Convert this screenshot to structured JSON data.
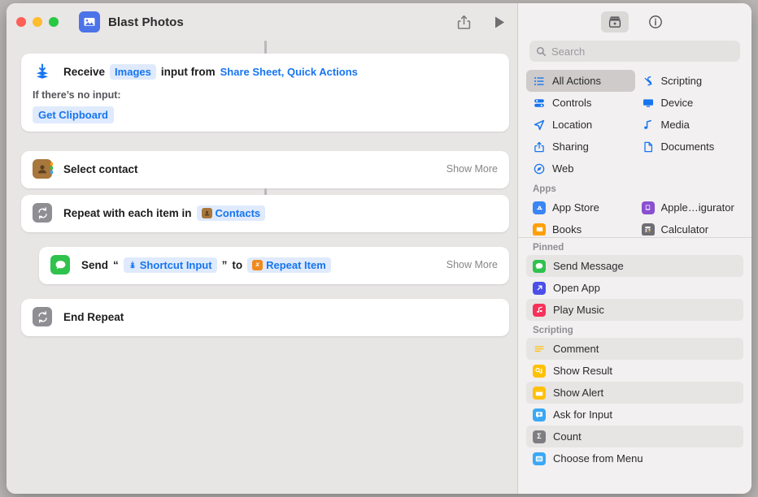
{
  "window": {
    "title": "Blast Photos",
    "app_icon": "photos-icon",
    "traffic_lights": [
      "close-button",
      "minimize-button",
      "zoom-button"
    ],
    "toolbar": {
      "share_label": "share-icon",
      "run_label": "play-icon"
    }
  },
  "workflow": {
    "actions": [
      {
        "id": "receive",
        "icon": "receive-input-icon",
        "prefix": "Receive",
        "token1": "Images",
        "middle": "input from",
        "token2": "Share Sheet, Quick Actions",
        "sub_label": "If there’s no input:",
        "sub_value": "Get Clipboard"
      },
      {
        "id": "select-contact",
        "icon": "contacts-icon",
        "title": "Select contact",
        "show_more": "Show More"
      },
      {
        "id": "repeat-with-each",
        "icon": "repeat-icon",
        "prefix": "Repeat with each item in",
        "token": "Contacts",
        "token_icon": "contacts-icon"
      },
      {
        "id": "send-message",
        "icon": "messages-icon",
        "prefix": "Send",
        "quote_open": "“",
        "token1": "Shortcut Input",
        "token1_icon": "shortcut-input-icon",
        "quote_close": "”",
        "middle": "to",
        "token2": "Repeat Item",
        "token2_icon": "variable-icon",
        "show_more": "Show More"
      },
      {
        "id": "end-repeat",
        "icon": "repeat-icon",
        "title": "End Repeat"
      }
    ]
  },
  "sidebar": {
    "tools": [
      {
        "name": "action-library-button",
        "icon": "library-icon",
        "selected": true
      },
      {
        "name": "info-button",
        "icon": "info-circle-icon",
        "selected": false
      }
    ],
    "search": {
      "placeholder": "Search",
      "value": "",
      "icon": "search-icon"
    },
    "categories": [
      {
        "label": "All Actions",
        "icon": "list-icon",
        "selected": true
      },
      {
        "label": "Scripting",
        "icon": "scripting-icon",
        "selected": false
      },
      {
        "label": "Controls",
        "icon": "controls-icon",
        "selected": false
      },
      {
        "label": "Device",
        "icon": "device-icon",
        "selected": false
      },
      {
        "label": "Location",
        "icon": "location-icon",
        "selected": false
      },
      {
        "label": "Media",
        "icon": "media-note-icon",
        "selected": false
      },
      {
        "label": "Sharing",
        "icon": "share-icon",
        "selected": false
      },
      {
        "label": "Documents",
        "icon": "document-icon",
        "selected": false
      },
      {
        "label": "Web",
        "icon": "compass-icon",
        "selected": false
      }
    ],
    "apps_header": "Apps",
    "apps": [
      {
        "label": "App Store",
        "icon": "app-store-icon",
        "color": "#3b85f5"
      },
      {
        "label": "Apple…igurator",
        "icon": "apple-configurator-icon",
        "color": "#8a4fd1"
      },
      {
        "label": "Books",
        "icon": "books-icon",
        "color": "#ff9f0a"
      },
      {
        "label": "Calculator",
        "icon": "calculator-icon",
        "color": "#6e6e73"
      }
    ],
    "pinned_header": "Pinned",
    "pinned": [
      {
        "label": "Send Message",
        "icon": "messages-icon",
        "color": "#2fc24c"
      },
      {
        "label": "Open App",
        "icon": "open-app-icon",
        "color": "#4c4fe8"
      },
      {
        "label": "Play Music",
        "icon": "music-icon",
        "color": "#f8315a"
      }
    ],
    "scripting_header": "Scripting",
    "scripting": [
      {
        "label": "Comment",
        "icon": "comment-icon",
        "color": "#ffffff"
      },
      {
        "label": "Show Result",
        "icon": "show-result-icon",
        "color": "#ffc008"
      },
      {
        "label": "Show Alert",
        "icon": "show-alert-icon",
        "color": "#ffc008"
      },
      {
        "label": "Ask for Input",
        "icon": "ask-for-input-icon",
        "color": "#3aa8f5"
      },
      {
        "label": "Count",
        "icon": "count-icon",
        "color": "#7d7d82"
      },
      {
        "label": "Choose from Menu",
        "icon": "choose-from-menu-icon",
        "color": "#3aa8f5"
      }
    ]
  },
  "colors": {
    "accent_blue": "#1675f0",
    "pill_bg": "#dfeafc",
    "canvas": "#e8e5e5",
    "card": "#ffffff"
  }
}
